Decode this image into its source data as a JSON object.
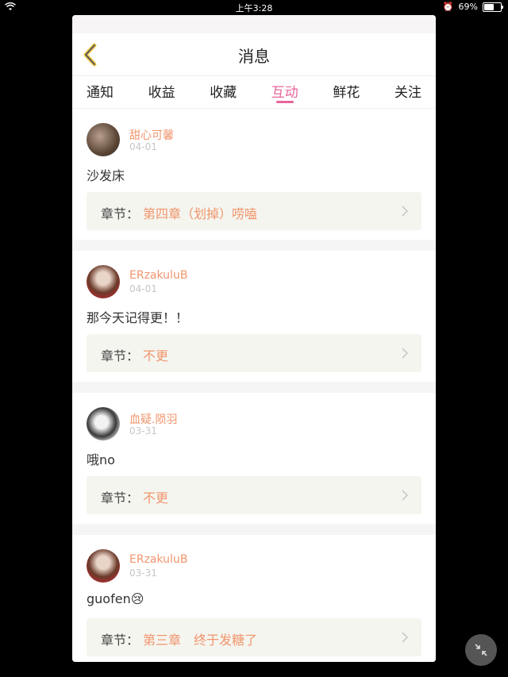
{
  "status_bar": {
    "time": "上午3:28",
    "battery": "69%",
    "battery_level": 0.69
  },
  "header": {
    "title": "消息"
  },
  "tabs": [
    {
      "label": "通知"
    },
    {
      "label": "收益"
    },
    {
      "label": "收藏"
    },
    {
      "label": "互动",
      "active": true
    },
    {
      "label": "鲜花"
    },
    {
      "label": "关注"
    }
  ],
  "chapter_label": "章节：",
  "messages": [
    {
      "user": "甜心可馨",
      "date": "04-01",
      "comment": "沙发床",
      "chapter": "第四章（划掉）唠嗑"
    },
    {
      "user": "ERzakuluB",
      "date": "04-01",
      "comment": "那今天记得更！！",
      "chapter": "不更"
    },
    {
      "user": "血疑.陨羽",
      "date": "03-31",
      "comment": "哦no",
      "chapter": "不更"
    },
    {
      "user": "ERzakuluB",
      "date": "03-31",
      "comment": "guofen😢",
      "chapter": "第三章　终于发糖了"
    }
  ],
  "colors": {
    "accent": "#e8649a",
    "username": "#f0956c",
    "chapter_bg": "#f5f5ef"
  }
}
